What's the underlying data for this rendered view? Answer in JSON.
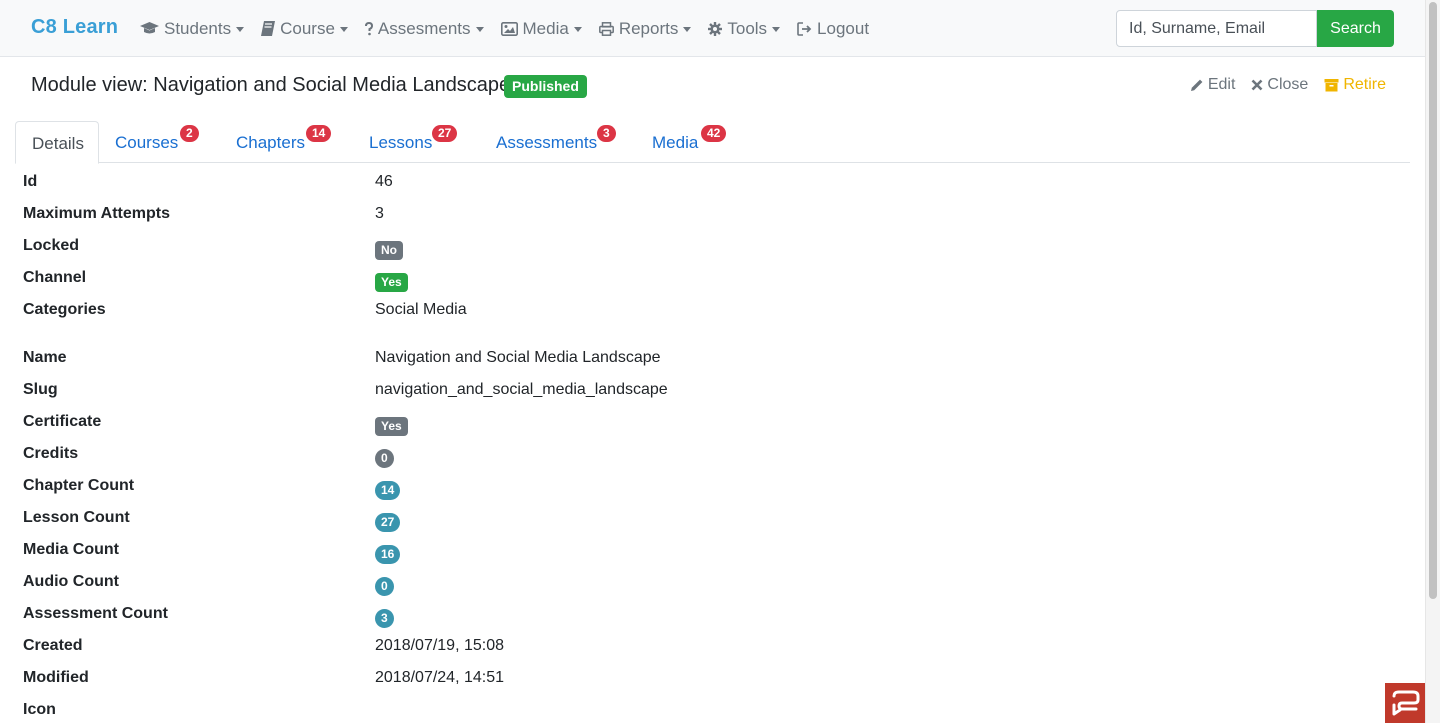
{
  "navbar": {
    "brand": "C8 Learn",
    "items": [
      {
        "label": "Students",
        "icon": "graduation-cap-icon",
        "dropdown": true
      },
      {
        "label": "Course",
        "icon": "book-icon",
        "dropdown": true
      },
      {
        "label": "Assesments",
        "icon": "question-icon",
        "dropdown": true
      },
      {
        "label": "Media",
        "icon": "image-icon",
        "dropdown": true
      },
      {
        "label": "Reports",
        "icon": "print-icon",
        "dropdown": true
      },
      {
        "label": "Tools",
        "icon": "gear-icon",
        "dropdown": true
      },
      {
        "label": "Logout",
        "icon": "sign-out-icon",
        "dropdown": false
      }
    ],
    "search_placeholder": "Id, Surname, Email",
    "search_button": "Search"
  },
  "header": {
    "title": "Module view: Navigation and Social Media Landscape",
    "status_badge": "Published",
    "actions": {
      "edit": "Edit",
      "close": "Close",
      "retire": "Retire"
    }
  },
  "tabs": [
    {
      "label": "Details",
      "active": true
    },
    {
      "label": "Courses",
      "count": "2"
    },
    {
      "label": "Chapters",
      "count": "14"
    },
    {
      "label": "Lessons",
      "count": "27"
    },
    {
      "label": "Assessments",
      "count": "3"
    },
    {
      "label": "Media",
      "count": "42"
    }
  ],
  "details": {
    "id": {
      "label": "Id",
      "value": "46"
    },
    "max_attempts": {
      "label": "Maximum Attempts",
      "value": "3"
    },
    "locked": {
      "label": "Locked",
      "value": "No"
    },
    "channel": {
      "label": "Channel",
      "value": "Yes"
    },
    "categories": {
      "label": "Categories",
      "value": "Social Media"
    },
    "name": {
      "label": "Name",
      "value": "Navigation and Social Media Landscape"
    },
    "slug": {
      "label": "Slug",
      "value": "navigation_and_social_media_landscape"
    },
    "certificate": {
      "label": "Certificate",
      "value": "Yes"
    },
    "credits": {
      "label": "Credits",
      "value": "0"
    },
    "chapter_count": {
      "label": "Chapter Count",
      "value": "14"
    },
    "lesson_count": {
      "label": "Lesson Count",
      "value": "27"
    },
    "media_count": {
      "label": "Media Count",
      "value": "16"
    },
    "audio_count": {
      "label": "Audio Count",
      "value": "0"
    },
    "assessment_count": {
      "label": "Assessment Count",
      "value": "3"
    },
    "created": {
      "label": "Created",
      "value": "2018/07/19, 15:08"
    },
    "modified": {
      "label": "Modified",
      "value": "2018/07/24, 14:51"
    },
    "icon": {
      "label": "Icon",
      "value": ""
    }
  },
  "colors": {
    "brand": "#3a9fd6",
    "success": "#28a745",
    "danger": "#dc3545",
    "secondary": "#6c757d",
    "info": "#3a95ae",
    "warning": "#f0b500",
    "link": "#1a6fd1"
  },
  "help_widget": {
    "icon": "help-chat-icon"
  }
}
